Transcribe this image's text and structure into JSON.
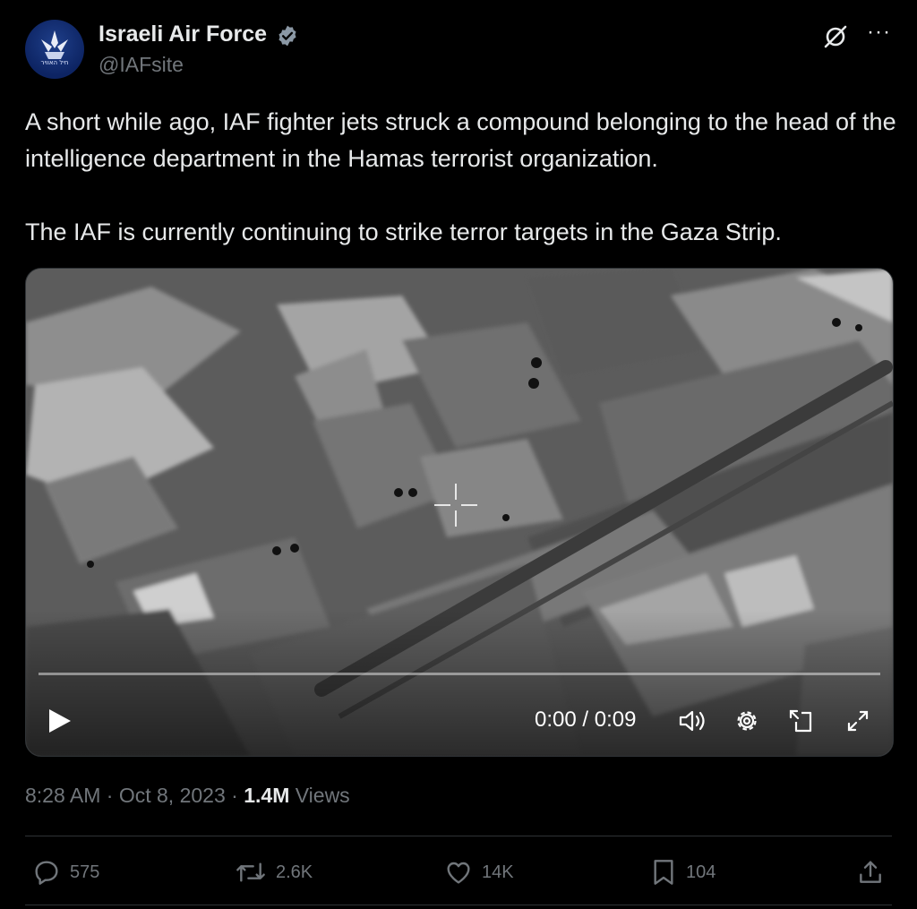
{
  "author": {
    "name": "Israeli Air Force",
    "handle": "@IAFsite",
    "avatar_caption": "חיל האוויר"
  },
  "post": {
    "text": "A short while ago, IAF fighter jets struck a compound belonging to the head of the intelligence department in the Hamas terrorist organization.\n\nThe IAF is currently continuing to strike terror targets in the Gaza Strip."
  },
  "video": {
    "time": "0:00 / 0:09",
    "progress": 0
  },
  "meta": {
    "time": "8:28 AM",
    "separator": "·",
    "date": "Oct 8, 2023",
    "views_count": "1.4M",
    "views_label": "Views"
  },
  "actions": {
    "replies": "575",
    "reposts": "2.6K",
    "likes": "14K",
    "bookmarks": "104"
  },
  "icons": [
    "verified-icon",
    "grok-icon",
    "more-icon",
    "play-icon",
    "volume-icon",
    "settings-icon",
    "picture-in-picture-icon",
    "fullscreen-icon",
    "reply-icon",
    "repost-icon",
    "like-icon",
    "bookmark-icon",
    "share-icon"
  ],
  "colors": {
    "verified": "#8b98a5",
    "muted": "#71767b",
    "text": "#e7e9ea"
  }
}
